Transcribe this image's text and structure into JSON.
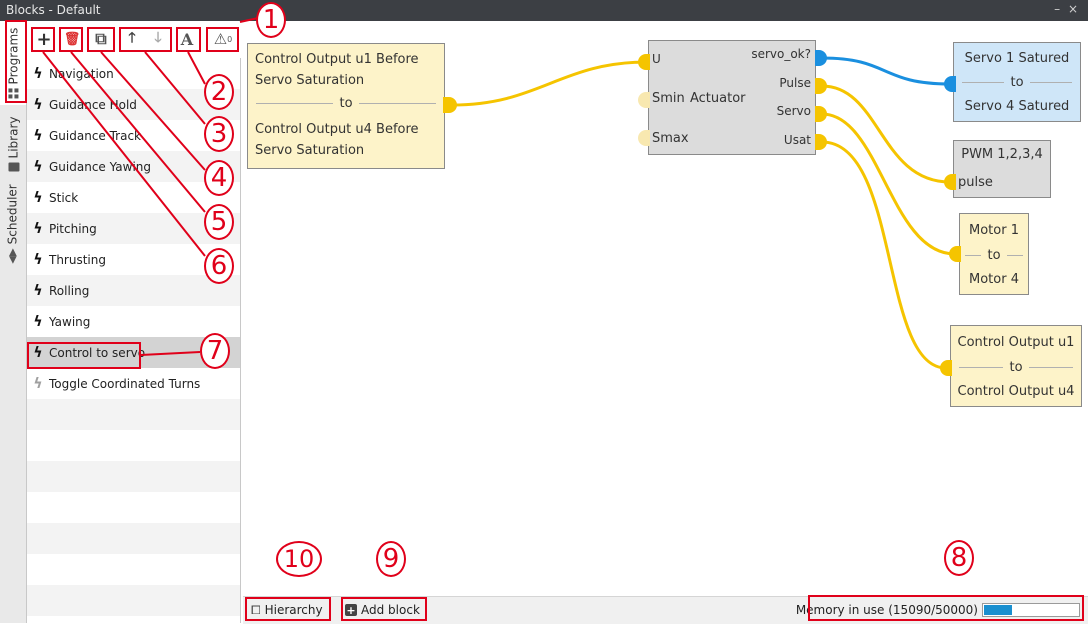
{
  "window": {
    "title": "Blocks - Default",
    "controls": "– ×"
  },
  "side_tabs": [
    {
      "label": "Programs",
      "icon": "grid-icon"
    },
    {
      "label": "Library",
      "icon": "book-icon"
    },
    {
      "label": "Scheduler",
      "icon": "arrows-icon"
    }
  ],
  "toolbar": {
    "add": "+",
    "delete": "🗑",
    "copy": "⧉",
    "up": "🡑",
    "down": "🡓",
    "font": "A",
    "warning": "⚠",
    "warning_count": "0"
  },
  "programs": [
    "Navigation",
    "Guidance Hold",
    "Guidance Track",
    "Guidance Yawing",
    "Stick",
    "Pitching",
    "Thrusting",
    "Rolling",
    "Yawing",
    "Control to servo",
    "Toggle Coordinated Turns"
  ],
  "selected_program": "Control to servo",
  "blocks": {
    "input_block": {
      "line1": "Control Output u1 Before",
      "line2": "Servo Saturation",
      "sep": "to",
      "line3": "Control Output u4 Before",
      "line4": "Servo Saturation"
    },
    "actuator": {
      "in_u": "U",
      "in_smin": "Smin",
      "title": "Actuator",
      "in_smax": "Smax",
      "out_ok": "servo_ok?",
      "out_pulse": "Pulse",
      "out_servo": "Servo",
      "out_usat": "Usat"
    },
    "servo_sat": {
      "line1": "Servo 1 Satured",
      "sep": "to",
      "line2": "Servo 4 Satured"
    },
    "pwm": {
      "line1": "PWM 1,2,3,4",
      "port": "pulse"
    },
    "motor": {
      "line1": "Motor 1",
      "sep": "to",
      "line2": "Motor 4"
    },
    "ctrl_out": {
      "line1": "Control Output u1",
      "sep": "to",
      "line2": "Control Output u4"
    }
  },
  "bottom": {
    "hierarchy": "Hierarchy",
    "add_block": "Add block",
    "memory": "Memory in use (15090/50000)",
    "memory_fraction": 0.3018
  },
  "callouts": [
    "1",
    "2",
    "3",
    "4",
    "5",
    "6",
    "7",
    "8",
    "9",
    "10"
  ],
  "colors": {
    "wire_yellow": "#f5c400",
    "wire_blue": "#1a8fdf",
    "annotation_red": "#e0001a"
  }
}
